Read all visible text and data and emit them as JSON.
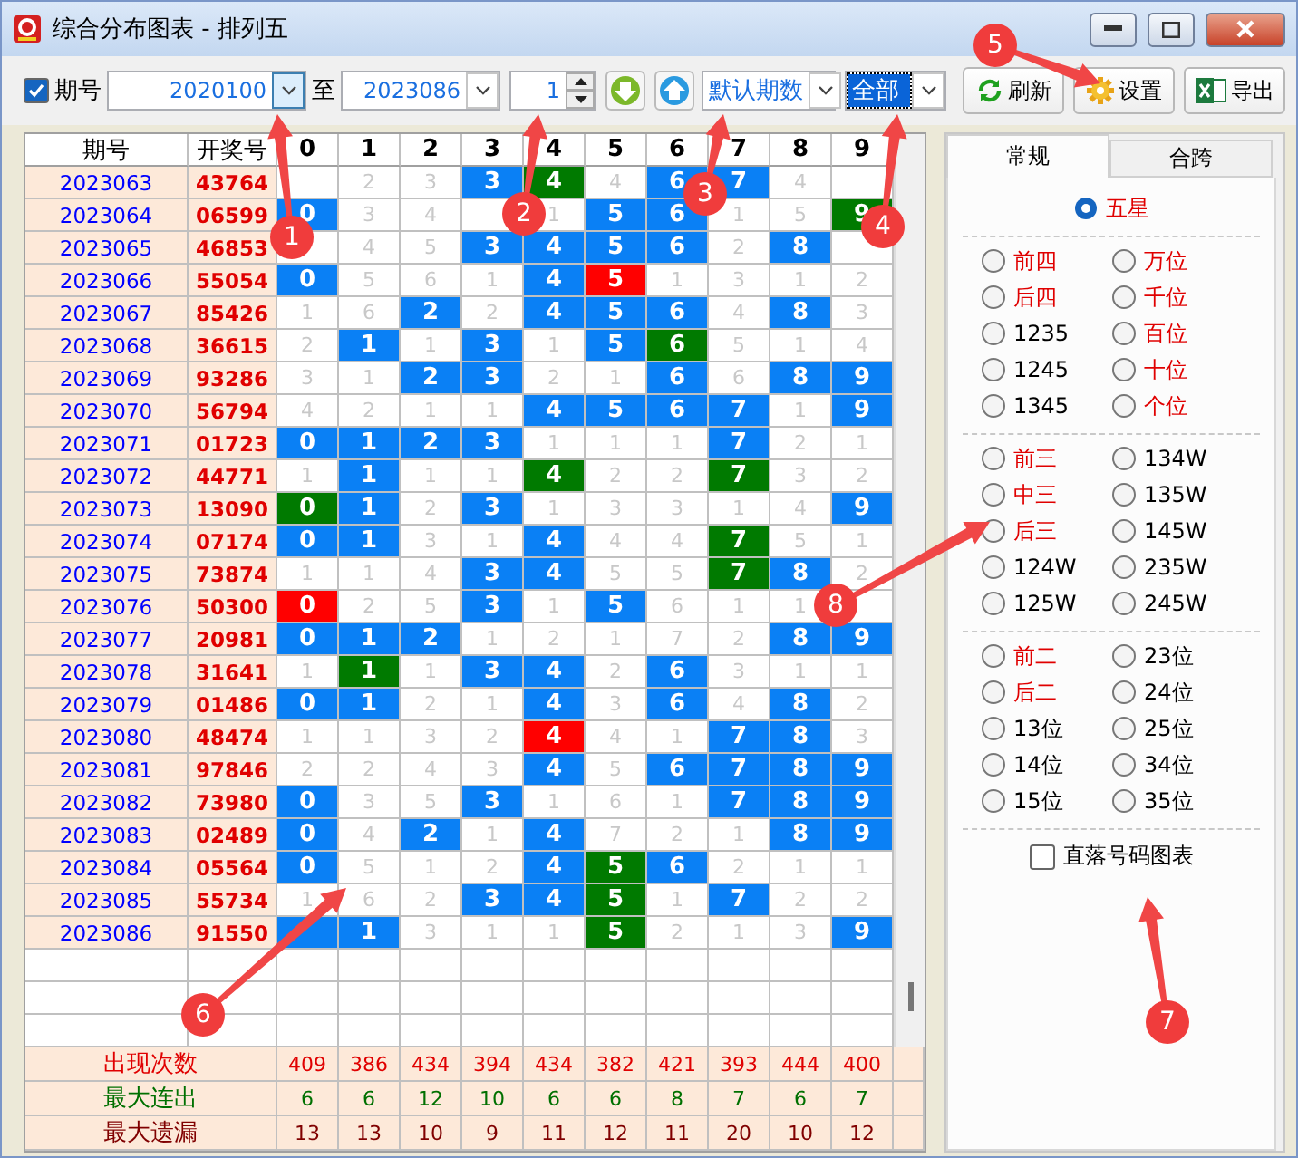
{
  "window": {
    "title": "综合分布图表 - 排列五"
  },
  "toolbar": {
    "period_toggle": {
      "label": "期号",
      "checked": true
    },
    "from": {
      "value": "2020100"
    },
    "to_label": "至",
    "to": {
      "value": "2023086"
    },
    "step": {
      "value": "1"
    },
    "period_mode": {
      "value": "默认期数"
    },
    "filter": {
      "value": "全部",
      "selected": true
    },
    "buttons": [
      {
        "label": "刷新",
        "kind": "refresh"
      },
      {
        "label": "设置",
        "kind": "settings"
      },
      {
        "label": "导出",
        "kind": "export"
      }
    ]
  },
  "table": {
    "period_header": "期号",
    "number_header": "开奖号",
    "columns": [
      "0",
      "1",
      "2",
      "3",
      "4",
      "5",
      "6",
      "7",
      "8",
      "9"
    ],
    "rows": [
      {
        "period": "2023063",
        "number": "43764",
        "cells": [
          {
            "kind": "miss"
          },
          {
            "text": "2",
            "kind": "miss"
          },
          {
            "text": "3",
            "kind": "miss"
          },
          {
            "text": "3",
            "kind": "hit"
          },
          {
            "text": "4",
            "kind": "repeat"
          },
          {
            "text": "4",
            "kind": "miss"
          },
          {
            "text": "6",
            "kind": "hit"
          },
          {
            "text": "7",
            "kind": "hit"
          },
          {
            "text": "4",
            "kind": "miss"
          },
          {
            "kind": "miss"
          }
        ]
      },
      {
        "period": "2023064",
        "number": "06599",
        "cells": [
          {
            "text": "0",
            "kind": "hit"
          },
          {
            "text": "3",
            "kind": "miss"
          },
          {
            "text": "4",
            "kind": "miss"
          },
          {
            "kind": "miss"
          },
          {
            "text": "1",
            "kind": "miss"
          },
          {
            "text": "5",
            "kind": "hit"
          },
          {
            "text": "6",
            "kind": "hit"
          },
          {
            "text": "1",
            "kind": "miss"
          },
          {
            "text": "5",
            "kind": "miss"
          },
          {
            "text": "9",
            "kind": "repeat"
          }
        ]
      },
      {
        "period": "2023065",
        "number": "46853",
        "cells": [
          {
            "kind": "miss"
          },
          {
            "text": "4",
            "kind": "miss"
          },
          {
            "text": "5",
            "kind": "miss"
          },
          {
            "text": "3",
            "kind": "hit"
          },
          {
            "text": "4",
            "kind": "hit"
          },
          {
            "text": "5",
            "kind": "hit"
          },
          {
            "text": "6",
            "kind": "hit"
          },
          {
            "text": "2",
            "kind": "miss"
          },
          {
            "text": "8",
            "kind": "hit"
          },
          {
            "kind": "miss"
          }
        ]
      },
      {
        "period": "2023066",
        "number": "55054",
        "cells": [
          {
            "text": "0",
            "kind": "hit"
          },
          {
            "text": "5",
            "kind": "miss"
          },
          {
            "text": "6",
            "kind": "miss"
          },
          {
            "text": "1",
            "kind": "miss"
          },
          {
            "text": "4",
            "kind": "hit"
          },
          {
            "text": "5",
            "kind": "cold"
          },
          {
            "text": "1",
            "kind": "miss"
          },
          {
            "text": "3",
            "kind": "miss"
          },
          {
            "text": "1",
            "kind": "miss"
          },
          {
            "text": "2",
            "kind": "miss"
          }
        ]
      },
      {
        "period": "2023067",
        "number": "85426",
        "cells": [
          {
            "text": "1",
            "kind": "miss"
          },
          {
            "text": "6",
            "kind": "miss"
          },
          {
            "text": "2",
            "kind": "hit"
          },
          {
            "text": "2",
            "kind": "miss"
          },
          {
            "text": "4",
            "kind": "hit"
          },
          {
            "text": "5",
            "kind": "hit"
          },
          {
            "text": "6",
            "kind": "hit"
          },
          {
            "text": "4",
            "kind": "miss"
          },
          {
            "text": "8",
            "kind": "hit"
          },
          {
            "text": "3",
            "kind": "miss"
          }
        ]
      },
      {
        "period": "2023068",
        "number": "36615",
        "cells": [
          {
            "text": "2",
            "kind": "miss"
          },
          {
            "text": "1",
            "kind": "hit"
          },
          {
            "text": "1",
            "kind": "miss"
          },
          {
            "text": "3",
            "kind": "hit"
          },
          {
            "text": "1",
            "kind": "miss"
          },
          {
            "text": "5",
            "kind": "hit"
          },
          {
            "text": "6",
            "kind": "repeat"
          },
          {
            "text": "5",
            "kind": "miss"
          },
          {
            "text": "1",
            "kind": "miss"
          },
          {
            "text": "4",
            "kind": "miss"
          }
        ]
      },
      {
        "period": "2023069",
        "number": "93286",
        "cells": [
          {
            "text": "3",
            "kind": "miss"
          },
          {
            "text": "1",
            "kind": "miss"
          },
          {
            "text": "2",
            "kind": "hit"
          },
          {
            "text": "3",
            "kind": "hit"
          },
          {
            "text": "2",
            "kind": "miss"
          },
          {
            "text": "1",
            "kind": "miss"
          },
          {
            "text": "6",
            "kind": "hit"
          },
          {
            "text": "6",
            "kind": "miss"
          },
          {
            "text": "8",
            "kind": "hit"
          },
          {
            "text": "9",
            "kind": "hit"
          }
        ]
      },
      {
        "period": "2023070",
        "number": "56794",
        "cells": [
          {
            "text": "4",
            "kind": "miss"
          },
          {
            "text": "2",
            "kind": "miss"
          },
          {
            "text": "1",
            "kind": "miss"
          },
          {
            "text": "1",
            "kind": "miss"
          },
          {
            "text": "4",
            "kind": "hit"
          },
          {
            "text": "5",
            "kind": "hit"
          },
          {
            "text": "6",
            "kind": "hit"
          },
          {
            "text": "7",
            "kind": "hit"
          },
          {
            "text": "1",
            "kind": "miss"
          },
          {
            "text": "9",
            "kind": "hit"
          }
        ]
      },
      {
        "period": "2023071",
        "number": "01723",
        "cells": [
          {
            "text": "0",
            "kind": "hit"
          },
          {
            "text": "1",
            "kind": "hit"
          },
          {
            "text": "2",
            "kind": "hit"
          },
          {
            "text": "3",
            "kind": "hit"
          },
          {
            "text": "1",
            "kind": "miss"
          },
          {
            "text": "1",
            "kind": "miss"
          },
          {
            "text": "1",
            "kind": "miss"
          },
          {
            "text": "7",
            "kind": "hit"
          },
          {
            "text": "2",
            "kind": "miss"
          },
          {
            "text": "1",
            "kind": "miss"
          }
        ]
      },
      {
        "period": "2023072",
        "number": "44771",
        "cells": [
          {
            "text": "1",
            "kind": "miss"
          },
          {
            "text": "1",
            "kind": "hit"
          },
          {
            "text": "1",
            "kind": "miss"
          },
          {
            "text": "1",
            "kind": "miss"
          },
          {
            "text": "4",
            "kind": "repeat"
          },
          {
            "text": "2",
            "kind": "miss"
          },
          {
            "text": "2",
            "kind": "miss"
          },
          {
            "text": "7",
            "kind": "repeat"
          },
          {
            "text": "3",
            "kind": "miss"
          },
          {
            "text": "2",
            "kind": "miss"
          }
        ]
      },
      {
        "period": "2023073",
        "number": "13090",
        "cells": [
          {
            "text": "0",
            "kind": "repeat"
          },
          {
            "text": "1",
            "kind": "hit"
          },
          {
            "text": "2",
            "kind": "miss"
          },
          {
            "text": "3",
            "kind": "hit"
          },
          {
            "text": "1",
            "kind": "miss"
          },
          {
            "text": "3",
            "kind": "miss"
          },
          {
            "text": "3",
            "kind": "miss"
          },
          {
            "text": "1",
            "kind": "miss"
          },
          {
            "text": "4",
            "kind": "miss"
          },
          {
            "text": "9",
            "kind": "hit"
          }
        ]
      },
      {
        "period": "2023074",
        "number": "07174",
        "cells": [
          {
            "text": "0",
            "kind": "hit"
          },
          {
            "text": "1",
            "kind": "hit"
          },
          {
            "text": "3",
            "kind": "miss"
          },
          {
            "text": "1",
            "kind": "miss"
          },
          {
            "text": "4",
            "kind": "hit"
          },
          {
            "text": "4",
            "kind": "miss"
          },
          {
            "text": "4",
            "kind": "miss"
          },
          {
            "text": "7",
            "kind": "repeat"
          },
          {
            "text": "5",
            "kind": "miss"
          },
          {
            "text": "1",
            "kind": "miss"
          }
        ]
      },
      {
        "period": "2023075",
        "number": "73874",
        "cells": [
          {
            "text": "1",
            "kind": "miss"
          },
          {
            "text": "1",
            "kind": "miss"
          },
          {
            "text": "4",
            "kind": "miss"
          },
          {
            "text": "3",
            "kind": "hit"
          },
          {
            "text": "4",
            "kind": "hit"
          },
          {
            "text": "5",
            "kind": "miss"
          },
          {
            "text": "5",
            "kind": "miss"
          },
          {
            "text": "7",
            "kind": "repeat"
          },
          {
            "text": "8",
            "kind": "hit"
          },
          {
            "text": "2",
            "kind": "miss"
          }
        ]
      },
      {
        "period": "2023076",
        "number": "50300",
        "cells": [
          {
            "text": "0",
            "kind": "cold"
          },
          {
            "text": "2",
            "kind": "miss"
          },
          {
            "text": "5",
            "kind": "miss"
          },
          {
            "text": "3",
            "kind": "hit"
          },
          {
            "text": "1",
            "kind": "miss"
          },
          {
            "text": "5",
            "kind": "hit"
          },
          {
            "text": "6",
            "kind": "miss"
          },
          {
            "text": "1",
            "kind": "miss"
          },
          {
            "text": "1",
            "kind": "miss"
          },
          {
            "kind": "miss"
          }
        ]
      },
      {
        "period": "2023077",
        "number": "20981",
        "cells": [
          {
            "text": "0",
            "kind": "hit"
          },
          {
            "text": "1",
            "kind": "hit"
          },
          {
            "text": "2",
            "kind": "hit"
          },
          {
            "text": "1",
            "kind": "miss"
          },
          {
            "text": "2",
            "kind": "miss"
          },
          {
            "text": "1",
            "kind": "miss"
          },
          {
            "text": "7",
            "kind": "miss"
          },
          {
            "text": "2",
            "kind": "miss"
          },
          {
            "text": "8",
            "kind": "hit"
          },
          {
            "text": "9",
            "kind": "hit"
          }
        ]
      },
      {
        "period": "2023078",
        "number": "31641",
        "cells": [
          {
            "text": "1",
            "kind": "miss"
          },
          {
            "text": "1",
            "kind": "repeat"
          },
          {
            "text": "1",
            "kind": "miss"
          },
          {
            "text": "3",
            "kind": "hit"
          },
          {
            "text": "4",
            "kind": "hit"
          },
          {
            "text": "2",
            "kind": "miss"
          },
          {
            "text": "6",
            "kind": "hit"
          },
          {
            "text": "3",
            "kind": "miss"
          },
          {
            "text": "1",
            "kind": "miss"
          },
          {
            "text": "1",
            "kind": "miss"
          }
        ]
      },
      {
        "period": "2023079",
        "number": "01486",
        "cells": [
          {
            "text": "0",
            "kind": "hit"
          },
          {
            "text": "1",
            "kind": "hit"
          },
          {
            "text": "2",
            "kind": "miss"
          },
          {
            "text": "1",
            "kind": "miss"
          },
          {
            "text": "4",
            "kind": "hit"
          },
          {
            "text": "3",
            "kind": "miss"
          },
          {
            "text": "6",
            "kind": "hit"
          },
          {
            "text": "4",
            "kind": "miss"
          },
          {
            "text": "8",
            "kind": "hit"
          },
          {
            "text": "2",
            "kind": "miss"
          }
        ]
      },
      {
        "period": "2023080",
        "number": "48474",
        "cells": [
          {
            "text": "1",
            "kind": "miss"
          },
          {
            "text": "1",
            "kind": "miss"
          },
          {
            "text": "3",
            "kind": "miss"
          },
          {
            "text": "2",
            "kind": "miss"
          },
          {
            "text": "4",
            "kind": "cold"
          },
          {
            "text": "4",
            "kind": "miss"
          },
          {
            "text": "1",
            "kind": "miss"
          },
          {
            "text": "7",
            "kind": "hit"
          },
          {
            "text": "8",
            "kind": "hit"
          },
          {
            "text": "3",
            "kind": "miss"
          }
        ]
      },
      {
        "period": "2023081",
        "number": "97846",
        "cells": [
          {
            "text": "2",
            "kind": "miss"
          },
          {
            "text": "2",
            "kind": "miss"
          },
          {
            "text": "4",
            "kind": "miss"
          },
          {
            "text": "3",
            "kind": "miss"
          },
          {
            "text": "4",
            "kind": "hit"
          },
          {
            "text": "5",
            "kind": "miss"
          },
          {
            "text": "6",
            "kind": "hit"
          },
          {
            "text": "7",
            "kind": "hit"
          },
          {
            "text": "8",
            "kind": "hit"
          },
          {
            "text": "9",
            "kind": "hit"
          }
        ]
      },
      {
        "period": "2023082",
        "number": "73980",
        "cells": [
          {
            "text": "0",
            "kind": "hit"
          },
          {
            "text": "3",
            "kind": "miss"
          },
          {
            "text": "5",
            "kind": "miss"
          },
          {
            "text": "3",
            "kind": "hit"
          },
          {
            "text": "1",
            "kind": "miss"
          },
          {
            "text": "6",
            "kind": "miss"
          },
          {
            "text": "1",
            "kind": "miss"
          },
          {
            "text": "7",
            "kind": "hit"
          },
          {
            "text": "8",
            "kind": "hit"
          },
          {
            "text": "9",
            "kind": "hit"
          }
        ]
      },
      {
        "period": "2023083",
        "number": "02489",
        "cells": [
          {
            "text": "0",
            "kind": "hit"
          },
          {
            "text": "4",
            "kind": "miss"
          },
          {
            "text": "2",
            "kind": "hit"
          },
          {
            "text": "1",
            "kind": "miss"
          },
          {
            "text": "4",
            "kind": "hit"
          },
          {
            "text": "7",
            "kind": "miss"
          },
          {
            "text": "2",
            "kind": "miss"
          },
          {
            "text": "1",
            "kind": "miss"
          },
          {
            "text": "8",
            "kind": "hit"
          },
          {
            "text": "9",
            "kind": "hit"
          }
        ]
      },
      {
        "period": "2023084",
        "number": "05564",
        "cells": [
          {
            "text": "0",
            "kind": "hit"
          },
          {
            "text": "5",
            "kind": "miss"
          },
          {
            "text": "1",
            "kind": "miss"
          },
          {
            "text": "2",
            "kind": "miss"
          },
          {
            "text": "4",
            "kind": "hit"
          },
          {
            "text": "5",
            "kind": "repeat"
          },
          {
            "text": "6",
            "kind": "hit"
          },
          {
            "text": "2",
            "kind": "miss"
          },
          {
            "text": "1",
            "kind": "miss"
          },
          {
            "text": "1",
            "kind": "miss"
          }
        ]
      },
      {
        "period": "2023085",
        "number": "55734",
        "cells": [
          {
            "text": "1",
            "kind": "miss"
          },
          {
            "text": "6",
            "kind": "miss"
          },
          {
            "text": "2",
            "kind": "miss"
          },
          {
            "text": "3",
            "kind": "hit"
          },
          {
            "text": "4",
            "kind": "hit"
          },
          {
            "text": "5",
            "kind": "repeat"
          },
          {
            "text": "1",
            "kind": "miss"
          },
          {
            "text": "7",
            "kind": "hit"
          },
          {
            "text": "2",
            "kind": "miss"
          },
          {
            "text": "2",
            "kind": "miss"
          }
        ]
      },
      {
        "period": "2023086",
        "number": "91550",
        "cells": [
          {
            "kind": "hit"
          },
          {
            "text": "1",
            "kind": "hit"
          },
          {
            "text": "3",
            "kind": "miss"
          },
          {
            "text": "1",
            "kind": "miss"
          },
          {
            "text": "1",
            "kind": "miss"
          },
          {
            "text": "5",
            "kind": "repeat"
          },
          {
            "text": "2",
            "kind": "miss"
          },
          {
            "text": "1",
            "kind": "miss"
          },
          {
            "text": "3",
            "kind": "miss"
          },
          {
            "text": "9",
            "kind": "hit"
          }
        ]
      }
    ],
    "stats": [
      {
        "label": "出现次数",
        "kind": "count",
        "values": [
          "409",
          "386",
          "434",
          "394",
          "434",
          "382",
          "421",
          "393",
          "444",
          "400"
        ]
      },
      {
        "label": "最大连出",
        "kind": "streak",
        "values": [
          "6",
          "6",
          "12",
          "10",
          "6",
          "6",
          "8",
          "7",
          "6",
          "7"
        ]
      },
      {
        "label": "最大遗漏",
        "kind": "gap",
        "values": [
          "13",
          "13",
          "10",
          "9",
          "11",
          "12",
          "11",
          "20",
          "10",
          "12"
        ]
      }
    ]
  },
  "panel": {
    "tabs": [
      {
        "label": "常规",
        "selected": true
      },
      {
        "label": "合跨",
        "selected": false
      }
    ],
    "groups": [
      {
        "options": [
          {
            "label": "五星",
            "selected": true,
            "emphasized": true
          }
        ]
      },
      {
        "options": [
          {
            "label": "前四",
            "selected": false,
            "emphasized": true
          },
          {
            "label": "万位",
            "selected": false,
            "emphasized": true
          },
          {
            "label": "后四",
            "selected": false,
            "emphasized": true
          },
          {
            "label": "千位",
            "selected": false,
            "emphasized": true
          },
          {
            "label": "1235",
            "selected": false,
            "emphasized": false
          },
          {
            "label": "百位",
            "selected": false,
            "emphasized": true
          },
          {
            "label": "1245",
            "selected": false,
            "emphasized": false
          },
          {
            "label": "十位",
            "selected": false,
            "emphasized": true
          },
          {
            "label": "1345",
            "selected": false,
            "emphasized": false
          },
          {
            "label": "个位",
            "selected": false,
            "emphasized": true
          }
        ]
      },
      {
        "options": [
          {
            "label": "前三",
            "selected": false,
            "emphasized": true
          },
          {
            "label": "134W",
            "selected": false,
            "emphasized": false
          },
          {
            "label": "中三",
            "selected": false,
            "emphasized": true
          },
          {
            "label": "135W",
            "selected": false,
            "emphasized": false
          },
          {
            "label": "后三",
            "selected": false,
            "emphasized": true
          },
          {
            "label": "145W",
            "selected": false,
            "emphasized": false
          },
          {
            "label": "124W",
            "selected": false,
            "emphasized": false
          },
          {
            "label": "235W",
            "selected": false,
            "emphasized": false
          },
          {
            "label": "125W",
            "selected": false,
            "emphasized": false
          },
          {
            "label": "245W",
            "selected": false,
            "emphasized": false
          }
        ]
      },
      {
        "options": [
          {
            "label": "前二",
            "selected": false,
            "emphasized": true
          },
          {
            "label": "23位",
            "selected": false,
            "emphasized": false
          },
          {
            "label": "后二",
            "selected": false,
            "emphasized": true
          },
          {
            "label": "24位",
            "selected": false,
            "emphasized": false
          },
          {
            "label": "13位",
            "selected": false,
            "emphasized": false
          },
          {
            "label": "25位",
            "selected": false,
            "emphasized": false
          },
          {
            "label": "14位",
            "selected": false,
            "emphasized": false
          },
          {
            "label": "34位",
            "selected": false,
            "emphasized": false
          },
          {
            "label": "15位",
            "selected": false,
            "emphasized": false
          },
          {
            "label": "35位",
            "selected": false,
            "emphasized": false
          }
        ]
      }
    ],
    "direct_chart": {
      "label": "直落号码图表",
      "checked": false
    }
  },
  "annotations": [
    {
      "number": "1"
    },
    {
      "number": "2"
    },
    {
      "number": "3"
    },
    {
      "number": "4"
    },
    {
      "number": "5"
    },
    {
      "number": "6"
    },
    {
      "number": "7"
    },
    {
      "number": "8"
    }
  ]
}
